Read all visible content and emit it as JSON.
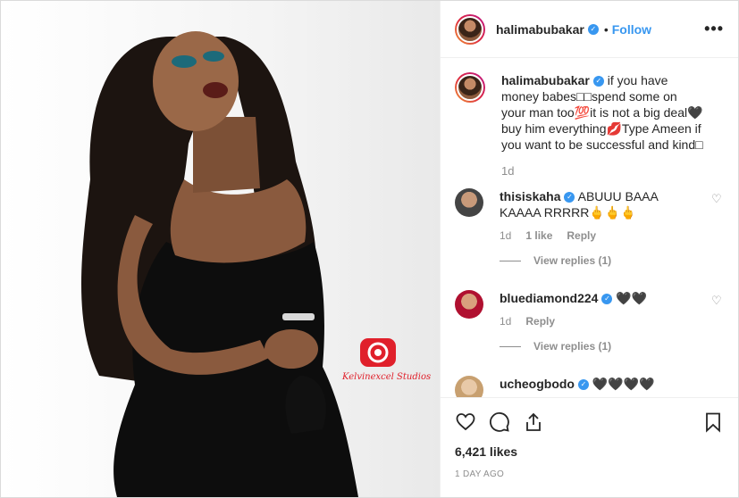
{
  "post": {
    "username": "halimabubakar",
    "verified_mark": "✓",
    "dot": "•",
    "follow_label": "Follow",
    "more_label": "•••",
    "watermark_text": "Kelvinexcel Studios"
  },
  "caption": {
    "username": "halimabubakar",
    "text": "if you have money babes□□spend some on your man too💯it is not a big deal🖤buy him everything💋Type Ameen if you want to be successful and kind□",
    "time": "1d"
  },
  "comments": [
    {
      "username": "thisiskaha",
      "text": "ABUUU BAAA KAAAA RRRRR🖕🖕🖕",
      "time": "1d",
      "likes": "1 like",
      "reply_label": "Reply",
      "view_replies": "View replies (1)"
    },
    {
      "username": "bluediamond224",
      "text": "🖤🖤",
      "time": "1d",
      "reply_label": "Reply",
      "view_replies": "View replies (1)"
    },
    {
      "username": "ucheogbodo",
      "text": "🖤🖤🖤🖤"
    }
  ],
  "actions": {
    "likes": "6,421 likes",
    "time_ago": "1 DAY AGO"
  },
  "colors": {
    "accent": "#3897f0",
    "muted": "#8e8e8e",
    "watermark_red": "#e0202b"
  },
  "icons": [
    "heart-icon",
    "comment-icon",
    "share-icon",
    "bookmark-icon",
    "more-options-icon"
  ]
}
